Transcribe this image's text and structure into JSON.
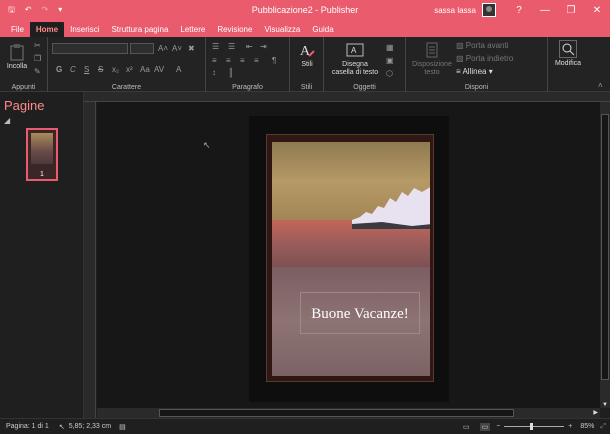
{
  "window": {
    "title": "Pubblicazione2  -  Publisher",
    "user": "sassa lassa",
    "help_icon": "?",
    "minimize": "—",
    "restore": "❐",
    "close": "✕",
    "accent_color": "#e95b6d"
  },
  "menu": {
    "tabs": [
      "File",
      "Home",
      "Inserisci",
      "Struttura pagina",
      "Lettere",
      "Revisione",
      "Visualizza",
      "Guida"
    ],
    "active_tab": "Home"
  },
  "ribbon": {
    "groups": {
      "clipboard": "Appunti",
      "font": "Carattere",
      "paragraph": "Paragrafo",
      "styles": "Stili",
      "objects": "Oggetti",
      "arrange": "Disponi"
    },
    "paste_label": "Incolla",
    "styles_button": "Stili",
    "draw_textbox_line1": "Disegna",
    "draw_textbox_line2": "casella di testo",
    "text_layout_line1": "Disposizione",
    "text_layout_line2": "testo",
    "bring_forward": "Porta avanti",
    "send_backward": "Porta indietro",
    "align": "Allinea",
    "modify": "Modifica"
  },
  "pages_panel": {
    "title": "Pagine",
    "page_number": "1"
  },
  "document": {
    "greeting": "Buone Vacanze!"
  },
  "status": {
    "page_info": "Pagina: 1 di 1",
    "cursor_pos": "5,85; 2,33 cm",
    "zoom": "85%"
  }
}
